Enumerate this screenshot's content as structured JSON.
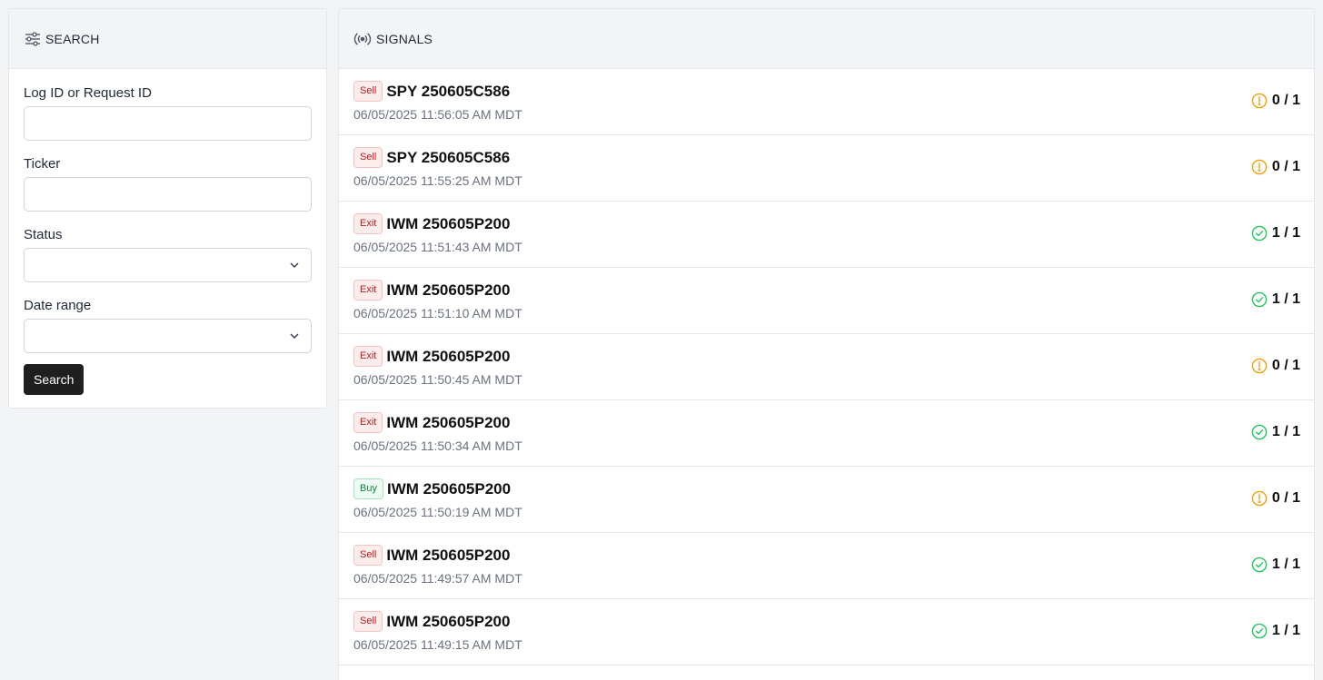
{
  "search_panel": {
    "title": "SEARCH",
    "fields": {
      "log_id_label": "Log ID or Request ID",
      "log_id_value": "",
      "ticker_label": "Ticker",
      "ticker_value": "",
      "status_label": "Status",
      "status_value": "",
      "date_range_label": "Date range",
      "date_range_value": ""
    },
    "search_button": "Search"
  },
  "signals_panel": {
    "title": "SIGNALS",
    "colors": {
      "warning": "#f59e0b",
      "success": "#22c55e"
    },
    "rows": [
      {
        "action": "Sell",
        "action_color": "red",
        "ticker": "SPY 250605C586",
        "timestamp": "06/05/2025 11:56:05 AM MDT",
        "status_icon": "warning-circle-icon",
        "count": "0 / 1"
      },
      {
        "action": "Sell",
        "action_color": "red",
        "ticker": "SPY 250605C586",
        "timestamp": "06/05/2025 11:55:25 AM MDT",
        "status_icon": "warning-circle-icon",
        "count": "0 / 1"
      },
      {
        "action": "Exit",
        "action_color": "red",
        "ticker": "IWM 250605P200",
        "timestamp": "06/05/2025 11:51:43 AM MDT",
        "status_icon": "check-circle-icon",
        "count": "1 / 1"
      },
      {
        "action": "Exit",
        "action_color": "red",
        "ticker": "IWM 250605P200",
        "timestamp": "06/05/2025 11:51:10 AM MDT",
        "status_icon": "check-circle-icon",
        "count": "1 / 1"
      },
      {
        "action": "Exit",
        "action_color": "red",
        "ticker": "IWM 250605P200",
        "timestamp": "06/05/2025 11:50:45 AM MDT",
        "status_icon": "warning-circle-icon",
        "count": "0 / 1"
      },
      {
        "action": "Exit",
        "action_color": "red",
        "ticker": "IWM 250605P200",
        "timestamp": "06/05/2025 11:50:34 AM MDT",
        "status_icon": "check-circle-icon",
        "count": "1 / 1"
      },
      {
        "action": "Buy",
        "action_color": "green",
        "ticker": "IWM 250605P200",
        "timestamp": "06/05/2025 11:50:19 AM MDT",
        "status_icon": "warning-circle-icon",
        "count": "0 / 1"
      },
      {
        "action": "Sell",
        "action_color": "red",
        "ticker": "IWM 250605P200",
        "timestamp": "06/05/2025 11:49:57 AM MDT",
        "status_icon": "check-circle-icon",
        "count": "1 / 1"
      },
      {
        "action": "Sell",
        "action_color": "red",
        "ticker": "IWM 250605P200",
        "timestamp": "06/05/2025 11:49:15 AM MDT",
        "status_icon": "check-circle-icon",
        "count": "1 / 1"
      }
    ]
  }
}
